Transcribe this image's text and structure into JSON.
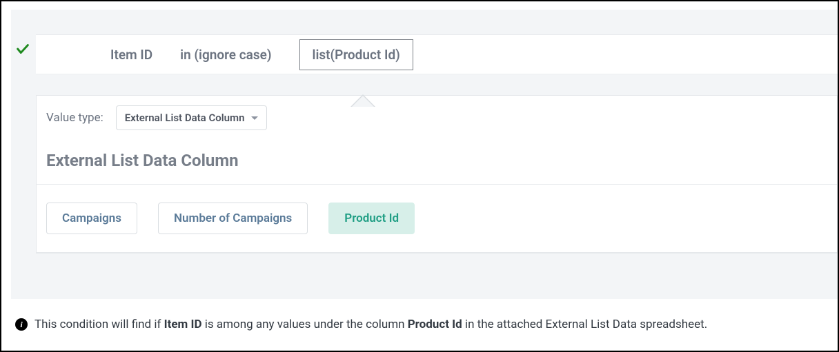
{
  "condition": {
    "field": "Item ID",
    "operator": "in (ignore case)",
    "value_expr": "list(Product Id)"
  },
  "config": {
    "value_type_label": "Value type:",
    "value_type_selected": "External List Data Column",
    "section_heading": "External List Data Column",
    "columns": [
      {
        "label": "Campaigns",
        "selected": false
      },
      {
        "label": "Number of Campaigns",
        "selected": false
      },
      {
        "label": "Product Id",
        "selected": true
      }
    ]
  },
  "info": {
    "prefix": "This condition will find if ",
    "bold1": "Item ID",
    "mid": " is among any values under the column ",
    "bold2": "Product Id",
    "suffix": " in the attached External List Data spreadsheet."
  }
}
